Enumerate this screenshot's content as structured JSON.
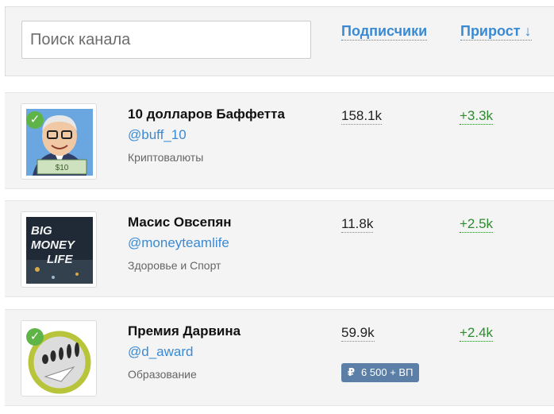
{
  "search": {
    "placeholder": "Поиск канала"
  },
  "columns": {
    "subscribers": "Подписчики",
    "growth": "Прирост ↓"
  },
  "channels": [
    {
      "name": "10 долларов Баффетта",
      "handle": "@buff_10",
      "category": "Криптовалюты",
      "subscribers": "158.1k",
      "growth": "+3.3k",
      "verified": true
    },
    {
      "name": "Масис Овсепян",
      "handle": "@moneyteamlife",
      "category": "Здоровье и Спорт",
      "subscribers": "11.8k",
      "growth": "+2.5k",
      "verified": false,
      "avatar_text": [
        "BIG",
        "MONEY",
        "LIFE"
      ]
    },
    {
      "name": "Премия Дарвина",
      "handle": "@d_award",
      "category": "Образование",
      "subscribers": "59.9k",
      "growth": "+2.4k",
      "verified": true,
      "ad_price": {
        "currency": "₽",
        "text": "6 500 + ВП"
      }
    }
  ],
  "colors": {
    "accent": "#3a8ad4",
    "growth": "#2e8b2e",
    "verified": "#5fb447",
    "price_badge": "#5b7fa6"
  }
}
